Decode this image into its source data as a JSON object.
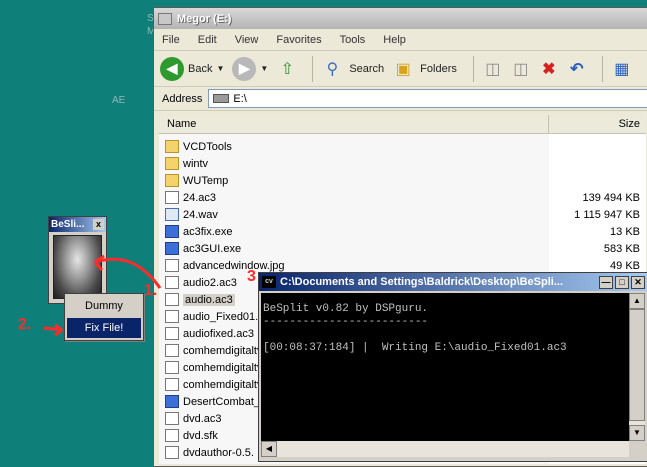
{
  "desktop": {
    "text_s": "S",
    "text_m": "M",
    "text_ae": "AE"
  },
  "explorer": {
    "title": "Megor (E:)",
    "menu": [
      "File",
      "Edit",
      "View",
      "Favorites",
      "Tools",
      "Help"
    ],
    "toolbar": {
      "back": "Back",
      "search": "Search",
      "folders": "Folders"
    },
    "address_label": "Address",
    "address_value": "E:\\",
    "columns": {
      "name": "Name",
      "size": "Size"
    },
    "files": [
      {
        "name": "VCDTools",
        "size": "",
        "icon": "folder-icon"
      },
      {
        "name": "wintv",
        "size": "",
        "icon": "folder-icon"
      },
      {
        "name": "WUTemp",
        "size": "",
        "icon": "folder-icon"
      },
      {
        "name": "24.ac3",
        "size": "139 494 KB",
        "icon": "file-icon"
      },
      {
        "name": "24.wav",
        "size": "1 115 947 KB",
        "icon": "media-file-icon"
      },
      {
        "name": "ac3fix.exe",
        "size": "13 KB",
        "icon": "exe-icon"
      },
      {
        "name": "ac3GUI.exe",
        "size": "583 KB",
        "icon": "exe-icon"
      },
      {
        "name": "advancedwindow.jpg",
        "size": "49 KB",
        "icon": "file-icon"
      },
      {
        "name": "audio2.ac3",
        "size": "",
        "icon": "file-icon"
      },
      {
        "name": "audio.ac3",
        "size": "",
        "icon": "file-icon"
      },
      {
        "name": "audio_Fixed01.",
        "size": "",
        "icon": "file-icon"
      },
      {
        "name": "audiofixed.ac3",
        "size": "",
        "icon": "file-icon"
      },
      {
        "name": "comhemdigitaltv",
        "size": "",
        "icon": "file-icon"
      },
      {
        "name": "comhemdigitaltv",
        "size": "",
        "icon": "file-icon"
      },
      {
        "name": "comhemdigitaltv",
        "size": "",
        "icon": "file-icon"
      },
      {
        "name": "DesertCombat_",
        "size": "",
        "icon": "exe-icon"
      },
      {
        "name": "dvd.ac3",
        "size": "",
        "icon": "file-icon"
      },
      {
        "name": "dvd.sfk",
        "size": "",
        "icon": "file-icon"
      },
      {
        "name": "dvdauthor-0.5.",
        "size": "",
        "icon": "file-icon"
      }
    ]
  },
  "besplit_widget": {
    "title": "BeSli...",
    "close": "x",
    "menu": [
      "Dummy",
      "Fix File!"
    ]
  },
  "console": {
    "title": "C:\\Documents and Settings\\Baldrick\\Desktop\\BeSpli...",
    "icon_text": "cv",
    "lines": [
      "BeSplit v0.82 by DSPguru.",
      "-------------------------",
      "",
      "[00:08:37:184] |  Writing E:\\audio_Fixed01.ac3"
    ]
  },
  "annotations": {
    "step1": "1.",
    "step2": "2.",
    "step3": "3"
  },
  "colors": {
    "desktop": "#0f7f79",
    "selection": "#0a246a",
    "annotation": "#ff2a2a"
  }
}
